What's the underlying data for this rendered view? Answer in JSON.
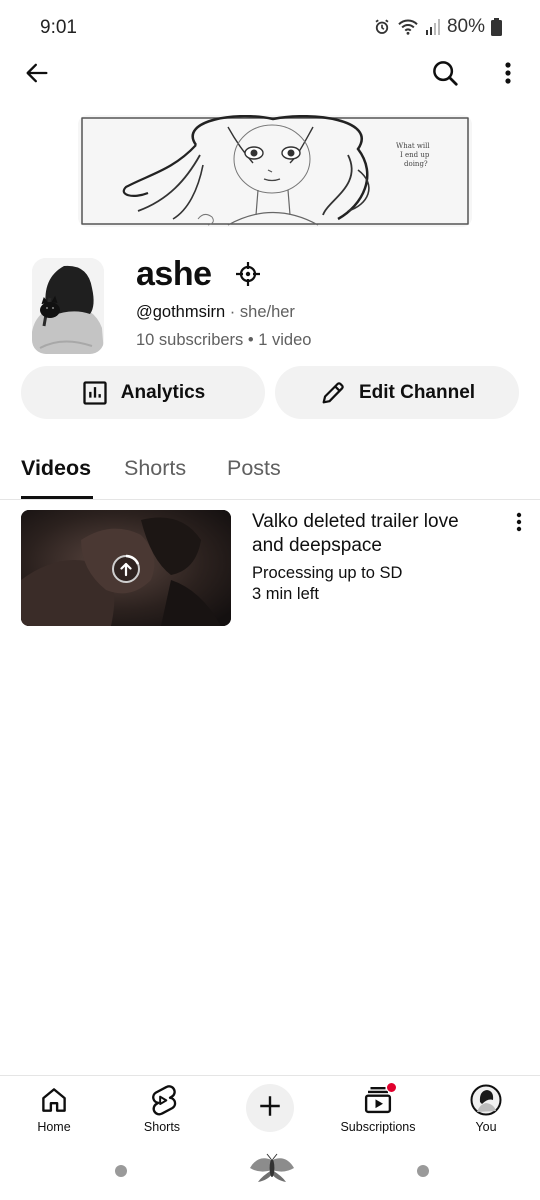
{
  "status_bar": {
    "time": "9:01",
    "battery": "80%",
    "icons": [
      "alarm-icon",
      "wifi-icon",
      "signal-icon",
      "battery-icon"
    ]
  },
  "app_bar": {
    "icons": [
      "back-arrow-icon",
      "search-icon",
      "more-vert-icon"
    ]
  },
  "banner": {
    "caption_lines": [
      "What will",
      "I end up",
      "doing?"
    ]
  },
  "channel": {
    "name": "ashe",
    "handle": "@gothmsirn",
    "separator": "·",
    "pronouns": "she/her",
    "stats": "10 subscribers • 1 video"
  },
  "actions": {
    "analytics_label": "Analytics",
    "edit_label": "Edit Channel"
  },
  "tabs": [
    {
      "label": "Videos",
      "active": true
    },
    {
      "label": "Shorts",
      "active": false
    },
    {
      "label": "Posts",
      "active": false
    }
  ],
  "videos": [
    {
      "title": "Valko deleted trailer love and deepspace",
      "status": "Processing up to SD",
      "time_left": "3 min left"
    }
  ],
  "bottom_nav": {
    "home": "Home",
    "shorts": "Shorts",
    "subscriptions": "Subscriptions",
    "you": "You"
  },
  "colors": {
    "text_primary": "#0f0f0f",
    "text_secondary": "#606060",
    "chip_bg": "#f2f2f2",
    "notification_dot": "#e1002d"
  }
}
